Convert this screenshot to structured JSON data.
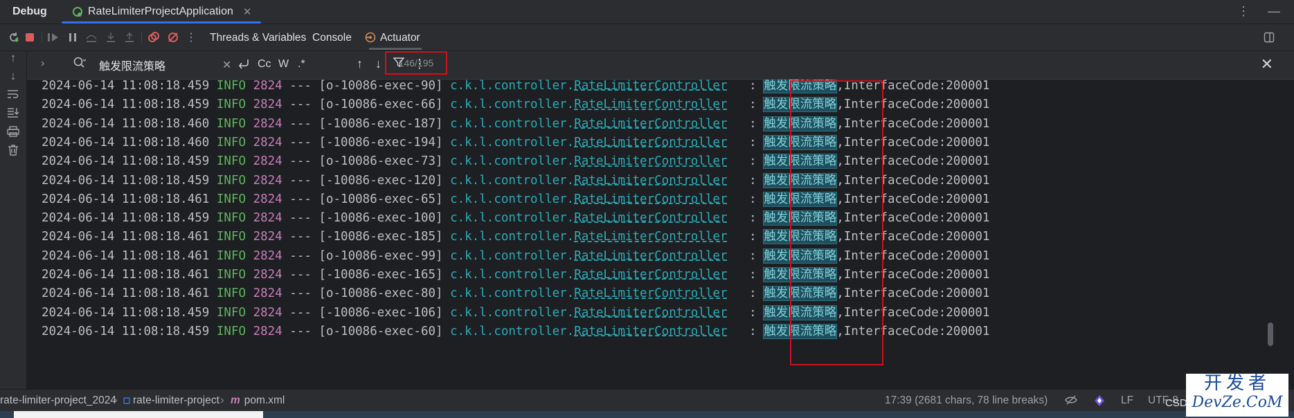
{
  "titlebar": {
    "debug_label": "Debug",
    "tab_label": "RateLimiterProjectApplication",
    "tab_close": "✕",
    "more": "⋮",
    "minimize": "—"
  },
  "toolbar": {
    "tabs": [
      "Threads & Variables",
      "Console",
      "Actuator"
    ],
    "actuator_icon": "⟲"
  },
  "search": {
    "query": "触发限流策略",
    "placeholder": "",
    "match_count": "146/195",
    "case_label": "Cc",
    "word_label": "W",
    "regex_label": ".*",
    "clear": "✕",
    "close": "✕"
  },
  "console": {
    "rows": [
      {
        "ts": "2024-06-14 11:08:18.459",
        "level": "INFO",
        "pid": "2824",
        "sep": "---",
        "thread": "[o-10086-exec-90]",
        "pkg": "c.k.l.controller.",
        "cls": "RateLimiterController",
        "colon": ":",
        "hl": "触发限流策略",
        "msg": ",InterfaceCode:200001"
      },
      {
        "ts": "2024-06-14 11:08:18.459",
        "level": "INFO",
        "pid": "2824",
        "sep": "---",
        "thread": "[o-10086-exec-66]",
        "pkg": "c.k.l.controller.",
        "cls": "RateLimiterController",
        "colon": ":",
        "hl": "触发限流策略",
        "msg": ",InterfaceCode:200001"
      },
      {
        "ts": "2024-06-14 11:08:18.460",
        "level": "INFO",
        "pid": "2824",
        "sep": "---",
        "thread": "[-10086-exec-187]",
        "pkg": "c.k.l.controller.",
        "cls": "RateLimiterController",
        "colon": ":",
        "hl": "触发限流策略",
        "msg": ",InterfaceCode:200001"
      },
      {
        "ts": "2024-06-14 11:08:18.460",
        "level": "INFO",
        "pid": "2824",
        "sep": "---",
        "thread": "[-10086-exec-194]",
        "pkg": "c.k.l.controller.",
        "cls": "RateLimiterController",
        "colon": ":",
        "hl": "触发限流策略",
        "msg": ",InterfaceCode:200001"
      },
      {
        "ts": "2024-06-14 11:08:18.459",
        "level": "INFO",
        "pid": "2824",
        "sep": "---",
        "thread": "[o-10086-exec-73]",
        "pkg": "c.k.l.controller.",
        "cls": "RateLimiterController",
        "colon": ":",
        "hl": "触发限流策略",
        "msg": ",InterfaceCode:200001"
      },
      {
        "ts": "2024-06-14 11:08:18.459",
        "level": "INFO",
        "pid": "2824",
        "sep": "---",
        "thread": "[-10086-exec-120]",
        "pkg": "c.k.l.controller.",
        "cls": "RateLimiterController",
        "colon": ":",
        "hl": "触发限流策略",
        "msg": ",InterfaceCode:200001"
      },
      {
        "ts": "2024-06-14 11:08:18.461",
        "level": "INFO",
        "pid": "2824",
        "sep": "---",
        "thread": "[o-10086-exec-65]",
        "pkg": "c.k.l.controller.",
        "cls": "RateLimiterController",
        "colon": ":",
        "hl": "触发限流策略",
        "msg": ",InterfaceCode:200001"
      },
      {
        "ts": "2024-06-14 11:08:18.459",
        "level": "INFO",
        "pid": "2824",
        "sep": "---",
        "thread": "[-10086-exec-100]",
        "pkg": "c.k.l.controller.",
        "cls": "RateLimiterController",
        "colon": ":",
        "hl": "触发限流策略",
        "msg": ",InterfaceCode:200001"
      },
      {
        "ts": "2024-06-14 11:08:18.461",
        "level": "INFO",
        "pid": "2824",
        "sep": "---",
        "thread": "[-10086-exec-185]",
        "pkg": "c.k.l.controller.",
        "cls": "RateLimiterController",
        "colon": ":",
        "hl": "触发限流策略",
        "msg": ",InterfaceCode:200001"
      },
      {
        "ts": "2024-06-14 11:08:18.461",
        "level": "INFO",
        "pid": "2824",
        "sep": "---",
        "thread": "[o-10086-exec-99]",
        "pkg": "c.k.l.controller.",
        "cls": "RateLimiterController",
        "colon": ":",
        "hl": "触发限流策略",
        "msg": ",InterfaceCode:200001"
      },
      {
        "ts": "2024-06-14 11:08:18.461",
        "level": "INFO",
        "pid": "2824",
        "sep": "---",
        "thread": "[-10086-exec-165]",
        "pkg": "c.k.l.controller.",
        "cls": "RateLimiterController",
        "colon": ":",
        "hl": "触发限流策略",
        "msg": ",InterfaceCode:200001"
      },
      {
        "ts": "2024-06-14 11:08:18.461",
        "level": "INFO",
        "pid": "2824",
        "sep": "---",
        "thread": "[o-10086-exec-80]",
        "pkg": "c.k.l.controller.",
        "cls": "RateLimiterController",
        "colon": ":",
        "hl": "触发限流策略",
        "msg": ",InterfaceCode:200001"
      },
      {
        "ts": "2024-06-14 11:08:18.459",
        "level": "INFO",
        "pid": "2824",
        "sep": "---",
        "thread": "[-10086-exec-106]",
        "pkg": "c.k.l.controller.",
        "cls": "RateLimiterController",
        "colon": ":",
        "hl": "触发限流策略",
        "msg": ",InterfaceCode:200001"
      },
      {
        "ts": "2024-06-14 11:08:18.459",
        "level": "INFO",
        "pid": "2824",
        "sep": "---",
        "thread": "[o-10086-exec-60]",
        "pkg": "c.k.l.controller.",
        "cls": "RateLimiterController",
        "colon": ":",
        "hl": "触发限流策略",
        "msg": ",InterfaceCode:200001"
      }
    ]
  },
  "statusbar": {
    "crumbs": [
      "rate-limiter-project_2024",
      "rate-limiter-project",
      "pom.xml"
    ],
    "position": "17:39 (2681 chars, 78 line breaks)",
    "line_sep": "LF",
    "encoding": "UTF-8"
  },
  "watermark": {
    "line1": "开发者",
    "line2": "DevZe.CoM",
    "partial": "CSD"
  },
  "colors": {
    "accent": "#3574f0",
    "annotation_red": "#d0101a",
    "info_green": "#5fb45f",
    "pid_magenta": "#c77dbb",
    "class_teal": "#2aacb8"
  }
}
